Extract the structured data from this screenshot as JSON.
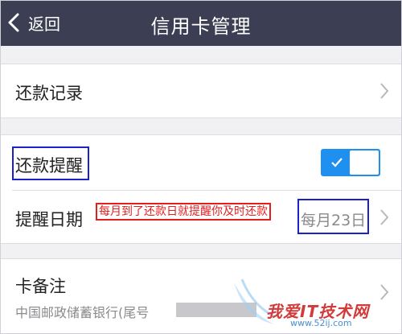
{
  "header": {
    "back_label": "返回",
    "title": "信用卡管理"
  },
  "repayment_records": {
    "label": "还款记录"
  },
  "reminder": {
    "label": "还款提醒",
    "enabled": true
  },
  "reminder_date": {
    "label": "提醒日期",
    "value": "每月23日"
  },
  "annotation": {
    "text": "每月到了还款日就提醒你及时还款"
  },
  "card_note": {
    "label": "卡备注",
    "subtext": "中国邮政储蓄银行(尾号"
  },
  "watermark": {
    "text": "我爱IT技术网",
    "url": "www.52ij.com"
  },
  "colors": {
    "header_bg": "#3c3f53",
    "toggle_on": "#1f8ff0",
    "annot_red": "#e02020",
    "annot_blue": "#1a22c8"
  }
}
